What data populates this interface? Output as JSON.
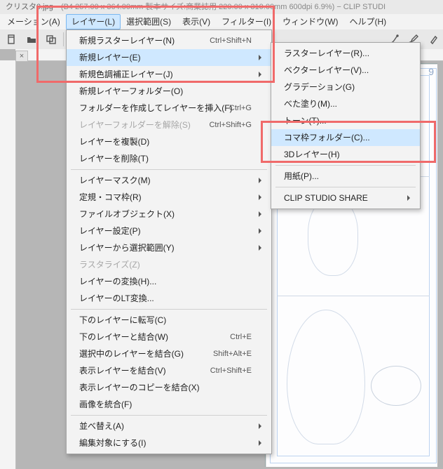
{
  "title": {
    "filename": "クリスタ0.jpg",
    "meta": "(B4 257.00 x 364.00mm 製本サイズ:商業誌用 220.00 x 310.00mm 600dpi 6.9%)  −  CLIP STUDI"
  },
  "menubar": {
    "items": [
      {
        "label": "メーション(A)"
      },
      {
        "label": "レイヤー(L)",
        "open": true
      },
      {
        "label": "選択範囲(S)"
      },
      {
        "label": "表示(V)"
      },
      {
        "label": "フィルター(I)"
      },
      {
        "label": "ウィンドウ(W)"
      },
      {
        "label": "ヘルプ(H)"
      }
    ]
  },
  "toolbar_icons": [
    "doc-icon",
    "open-icon",
    "overlay-icon",
    "",
    "brush-icon",
    "pen-icon",
    "marker-icon"
  ],
  "layer_menu": [
    {
      "label": "新規ラスターレイヤー(N)",
      "accel": "Ctrl+Shift+N"
    },
    {
      "label": "新規レイヤー(E)",
      "submenu": true,
      "selected": true
    },
    {
      "label": "新規色調補正レイヤー(J)",
      "submenu": true
    },
    {
      "label": "新規レイヤーフォルダー(O)"
    },
    {
      "label": "フォルダーを作成してレイヤーを挿入(F)",
      "accel": "Ctrl+G"
    },
    {
      "label": "レイヤーフォルダーを解除(S)",
      "accel": "Ctrl+Shift+G",
      "disabled": true
    },
    {
      "label": "レイヤーを複製(D)"
    },
    {
      "label": "レイヤーを削除(T)"
    },
    {
      "sep": true
    },
    {
      "label": "レイヤーマスク(M)",
      "submenu": true
    },
    {
      "label": "定規・コマ枠(R)",
      "submenu": true
    },
    {
      "label": "ファイルオブジェクト(X)",
      "submenu": true
    },
    {
      "label": "レイヤー設定(P)",
      "submenu": true
    },
    {
      "label": "レイヤーから選択範囲(Y)",
      "submenu": true
    },
    {
      "label": "ラスタライズ(Z)",
      "disabled": true
    },
    {
      "label": "レイヤーの変換(H)..."
    },
    {
      "label": "レイヤーのLT変換..."
    },
    {
      "sep": true
    },
    {
      "label": "下のレイヤーに転写(C)"
    },
    {
      "label": "下のレイヤーと結合(W)",
      "accel": "Ctrl+E"
    },
    {
      "label": "選択中のレイヤーを結合(G)",
      "accel": "Shift+Alt+E"
    },
    {
      "label": "表示レイヤーを結合(V)",
      "accel": "Ctrl+Shift+E"
    },
    {
      "label": "表示レイヤーのコピーを結合(X)"
    },
    {
      "label": "画像を統合(F)"
    },
    {
      "sep": true
    },
    {
      "label": "並べ替え(A)",
      "submenu": true
    },
    {
      "label": "編集対象にする(I)",
      "submenu": true
    }
  ],
  "new_layer_submenu": [
    {
      "label": "ラスターレイヤー(R)..."
    },
    {
      "label": "ベクターレイヤー(V)..."
    },
    {
      "label": "グラデーション(G)"
    },
    {
      "label": "べた塗り(M)..."
    },
    {
      "label": "トーン(T)..."
    },
    {
      "label": "コマ枠フォルダー(C)...",
      "selected": true
    },
    {
      "label": "3Dレイヤー(H)"
    },
    {
      "sep": true
    },
    {
      "label": "用紙(P)..."
    },
    {
      "sep": true
    },
    {
      "label": "CLIP STUDIO SHARE",
      "submenu": true
    }
  ],
  "tabclose": "×",
  "page_number": "9"
}
